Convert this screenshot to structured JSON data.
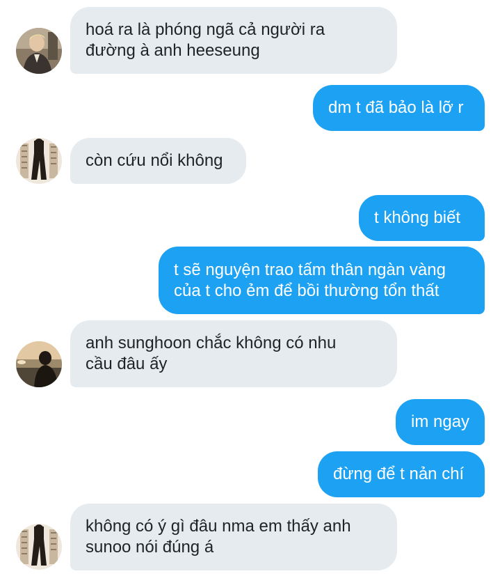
{
  "conversation": {
    "messages": [
      {
        "sender": "other",
        "avatar": "avatar-blond-suit",
        "lines": [
          "hoá ra là phóng ngã cả người ra",
          "đường à anh heeseung"
        ]
      },
      {
        "sender": "me",
        "lines": [
          "dm t đã bảo là lỡ r"
        ]
      },
      {
        "sender": "other",
        "avatar": "avatar-window-silhouette",
        "lines": [
          "còn cứu nổi không"
        ]
      },
      {
        "sender": "me",
        "lines": [
          "t không biết"
        ]
      },
      {
        "sender": "me",
        "lines": [
          "t sẽ nguyện trao tấm thân ngàn vàng",
          "của t cho ẻm để bồi thường tổn thất"
        ]
      },
      {
        "sender": "other",
        "avatar": "avatar-sunset-portrait",
        "lines": [
          "anh sunghoon chắc không có nhu",
          "cầu đâu ấy"
        ]
      },
      {
        "sender": "me",
        "lines": [
          "im ngay"
        ]
      },
      {
        "sender": "me",
        "lines": [
          "đừng để t nản chí"
        ]
      },
      {
        "sender": "other",
        "avatar": "avatar-window-silhouette",
        "lines": [
          "không có ý gì đâu nma em thấy anh",
          "sunoo nói đúng á"
        ]
      }
    ]
  },
  "colors": {
    "incoming_bubble": "#e6ebef",
    "outgoing_bubble": "#1da1f2",
    "incoming_text": "#1f2326",
    "outgoing_text": "#ffffff"
  }
}
